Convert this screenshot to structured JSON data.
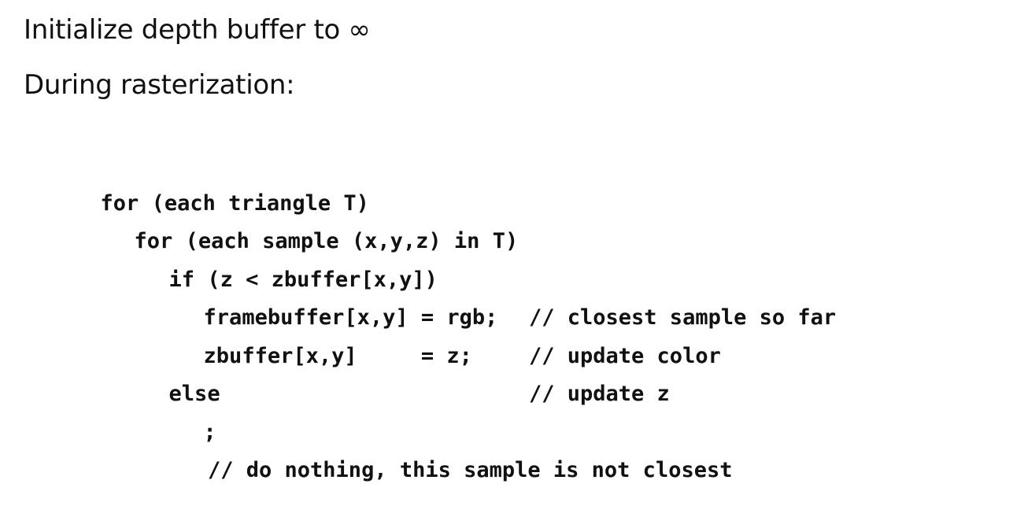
{
  "headings": {
    "line1": "Initialize depth buffer to ∞",
    "line2": "During rasterization:"
  },
  "code": {
    "lines": [
      {
        "text": "for (each triangle T)",
        "comment": ""
      },
      {
        "text": "for (each sample (x,y,z) in T)",
        "comment": ""
      },
      {
        "text": "if (z < zbuffer[x,y])",
        "comment": "// closest sample so far"
      },
      {
        "text": "framebuffer[x,y] = rgb;",
        "comment": "// update color"
      },
      {
        "text": "zbuffer[x,y]     = z;",
        "comment": "// update z"
      },
      {
        "text": "else",
        "comment": ""
      },
      {
        "text": ";",
        "comment": "// do nothing, this sample is not closest"
      }
    ]
  }
}
